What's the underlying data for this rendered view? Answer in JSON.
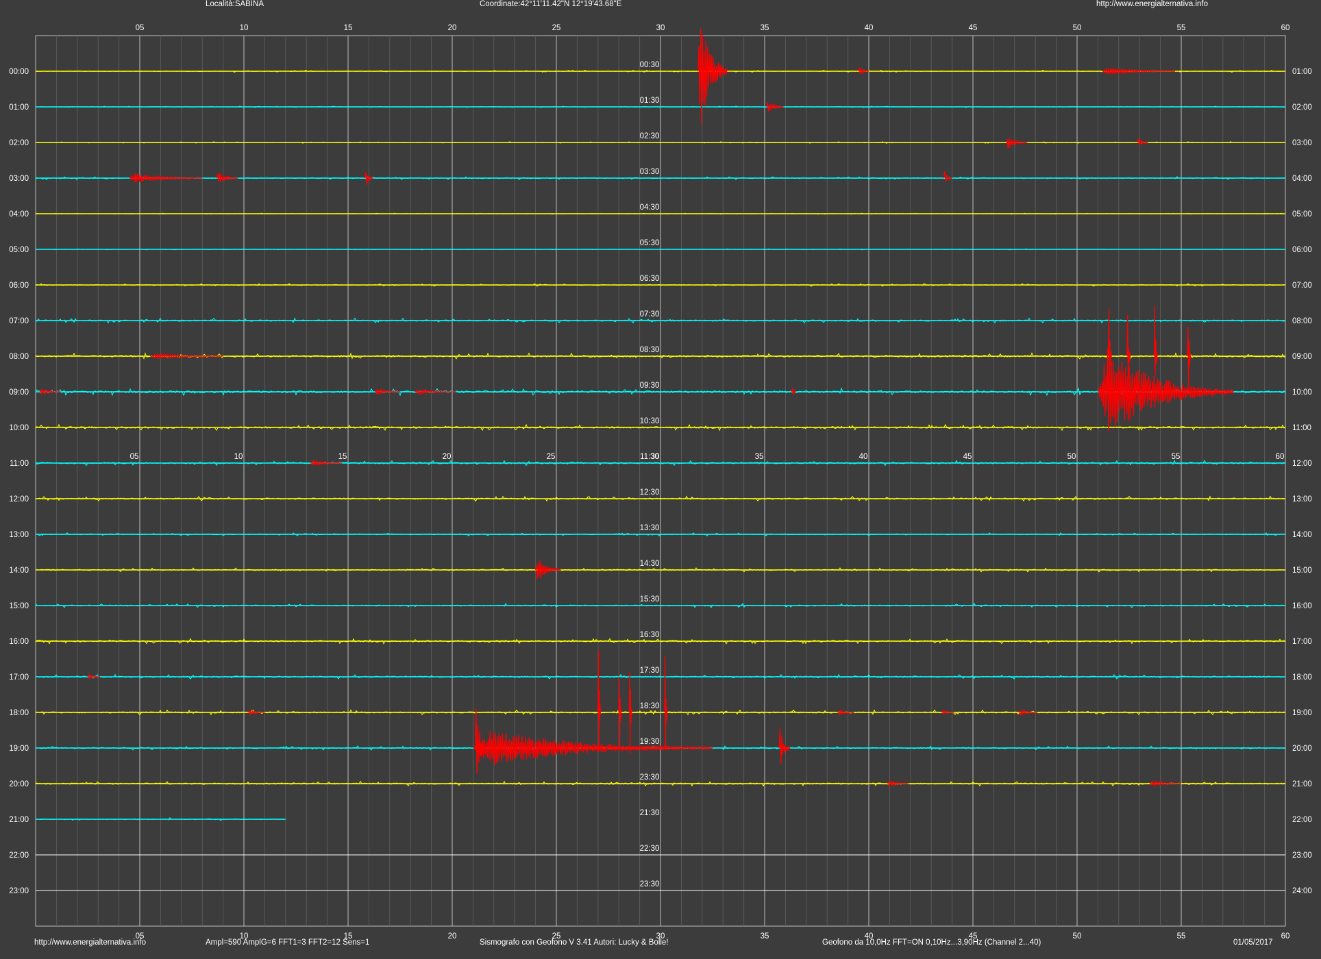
{
  "header": {
    "locality": "Località:SABINA",
    "coordinates": "Coordinate:42°11'11.42\"N  12°19'43.68\"E",
    "website": "http://www.energialternativa.info"
  },
  "footer": {
    "website": "http://www.energialternativa.info",
    "amplification": "Ampl=590 AmplG=6 FFT1=3 FFT2=12 Sens=1",
    "software": "Sismografo con Geofono V 3.41  Autori: Lucky & Bolle!",
    "geophone": "Geofono da 10,0Hz FFT=ON 0,10Hz...3,90Hz      (Channel 2...40)",
    "date": "01/05/2017"
  },
  "colors": {
    "background": "#3c3c3c",
    "trace_even": "#ffff00",
    "trace_odd": "#00ffff",
    "event": "#ff0000",
    "empty_trace": "#ffffff",
    "grid_major": "#bebebe",
    "grid_minor": "#5a5a5a"
  },
  "chart_data": {
    "type": "helicorder",
    "minute_ticks": [
      "05",
      "10",
      "15",
      "20",
      "25",
      "30",
      "35",
      "40",
      "45",
      "50",
      "55",
      "60"
    ],
    "inner_minute_ticks": [
      "05",
      "10",
      "15",
      "20",
      "25",
      "30",
      "35",
      "40",
      "45",
      "50",
      "55",
      "60"
    ],
    "xlim": [
      0,
      60
    ],
    "left_labels": [
      "00:00",
      "01:00",
      "02:00",
      "03:00",
      "04:00",
      "05:00",
      "06:00",
      "07:00",
      "08:00",
      "09:00",
      "10:00",
      "11:00",
      "12:00",
      "13:00",
      "14:00",
      "15:00",
      "16:00",
      "17:00",
      "18:00",
      "19:00",
      "20:00",
      "21:00",
      "22:00",
      "23:00"
    ],
    "right_labels": [
      "01:00",
      "02:00",
      "03:00",
      "04:00",
      "05:00",
      "06:00",
      "07:00",
      "08:00",
      "09:00",
      "10:00",
      "11:00",
      "12:00",
      "13:00",
      "14:00",
      "15:00",
      "16:00",
      "17:00",
      "18:00",
      "19:00",
      "20:00",
      "21:00",
      "22:00",
      "23:00",
      "24:00"
    ],
    "mid_labels": [
      "00:30",
      "01:30",
      "02:30",
      "03:30",
      "04:30",
      "05:30",
      "06:30",
      "07:30",
      "08:30",
      "09:30",
      "10:30",
      "11:30",
      "12:30",
      "13:30",
      "14:30",
      "15:30",
      "16:30",
      "17:30",
      "18:30",
      "19:30",
      "23:30",
      "21:30",
      "22:30",
      "23:30"
    ],
    "trace_end_minute": [
      60,
      60,
      60,
      60,
      60,
      60,
      60,
      60,
      60,
      60,
      60,
      60,
      60,
      60,
      60,
      60,
      60,
      60,
      60,
      60,
      60,
      12,
      0,
      0
    ],
    "noise_level": [
      0.2,
      0.15,
      0.15,
      0.3,
      0.1,
      0.1,
      0.25,
      0.45,
      0.6,
      0.7,
      0.55,
      0.5,
      0.45,
      0.3,
      0.4,
      0.4,
      0.5,
      0.45,
      0.45,
      0.4,
      0.45,
      0.3,
      0,
      0
    ],
    "events": [
      {
        "row": 0,
        "minute": 31.8,
        "duration": 1.4,
        "amplitude": 100
      },
      {
        "row": 0,
        "minute": 39.5,
        "duration": 0.5,
        "amplitude": 8
      },
      {
        "row": 0,
        "minute": 51.2,
        "duration": 3.5,
        "amplitude": 6
      },
      {
        "row": 1,
        "minute": 35.1,
        "duration": 0.8,
        "amplitude": 10
      },
      {
        "row": 2,
        "minute": 46.6,
        "duration": 1.0,
        "amplitude": 10
      },
      {
        "row": 2,
        "minute": 52.9,
        "duration": 0.5,
        "amplitude": 9
      },
      {
        "row": 3,
        "minute": 4.5,
        "duration": 3.5,
        "amplitude": 8
      },
      {
        "row": 3,
        "minute": 8.7,
        "duration": 1.0,
        "amplitude": 10
      },
      {
        "row": 3,
        "minute": 15.8,
        "duration": 0.4,
        "amplitude": 18
      },
      {
        "row": 3,
        "minute": 43.6,
        "duration": 0.4,
        "amplitude": 12
      },
      {
        "row": 8,
        "minute": 5.5,
        "duration": 3.5,
        "amplitude": 4
      },
      {
        "row": 9,
        "minute": 0.2,
        "duration": 1.0,
        "amplitude": 5
      },
      {
        "row": 9,
        "minute": 16.3,
        "duration": 1.2,
        "amplitude": 5
      },
      {
        "row": 9,
        "minute": 18.2,
        "duration": 2.0,
        "amplitude": 4
      },
      {
        "row": 9,
        "minute": 36.3,
        "duration": 0.2,
        "amplitude": 14
      },
      {
        "row": 9,
        "minute": 51.0,
        "duration": 6.5,
        "amplitude": 70
      },
      {
        "row": 8,
        "minute": 51.5,
        "duration": 0.15,
        "amplitude": 100
      },
      {
        "row": 8,
        "minute": 52.4,
        "duration": 0.15,
        "amplitude": 100
      },
      {
        "row": 8,
        "minute": 53.7,
        "duration": 0.15,
        "amplitude": 100
      },
      {
        "row": 8,
        "minute": 55.3,
        "duration": 0.15,
        "amplitude": 100
      },
      {
        "row": 11,
        "minute": 13.2,
        "duration": 1.5,
        "amplitude": 5
      },
      {
        "row": 14,
        "minute": 24.0,
        "duration": 1.2,
        "amplitude": 20
      },
      {
        "row": 17,
        "minute": 2.5,
        "duration": 0.6,
        "amplitude": 4
      },
      {
        "row": 18,
        "minute": 10.2,
        "duration": 0.8,
        "amplitude": 4
      },
      {
        "row": 18,
        "minute": 38.5,
        "duration": 0.8,
        "amplitude": 4
      },
      {
        "row": 18,
        "minute": 43.5,
        "duration": 0.6,
        "amplitude": 4
      },
      {
        "row": 18,
        "minute": 47.2,
        "duration": 0.9,
        "amplitude": 5
      },
      {
        "row": 19,
        "minute": 21.0,
        "duration": 11.5,
        "amplitude": 28
      },
      {
        "row": 19,
        "minute": 21.1,
        "duration": 0.4,
        "amplitude": 110
      },
      {
        "row": 19,
        "minute": 35.7,
        "duration": 0.5,
        "amplitude": 40
      },
      {
        "row": 18,
        "minute": 27.0,
        "duration": 0.12,
        "amplitude": 145
      },
      {
        "row": 18,
        "minute": 28.0,
        "duration": 0.12,
        "amplitude": 145
      },
      {
        "row": 18,
        "minute": 28.5,
        "duration": 0.12,
        "amplitude": 145
      },
      {
        "row": 18,
        "minute": 30.2,
        "duration": 0.12,
        "amplitude": 145
      },
      {
        "row": 20,
        "minute": 40.9,
        "duration": 1.0,
        "amplitude": 5
      },
      {
        "row": 20,
        "minute": 53.5,
        "duration": 1.5,
        "amplitude": 5
      }
    ]
  }
}
